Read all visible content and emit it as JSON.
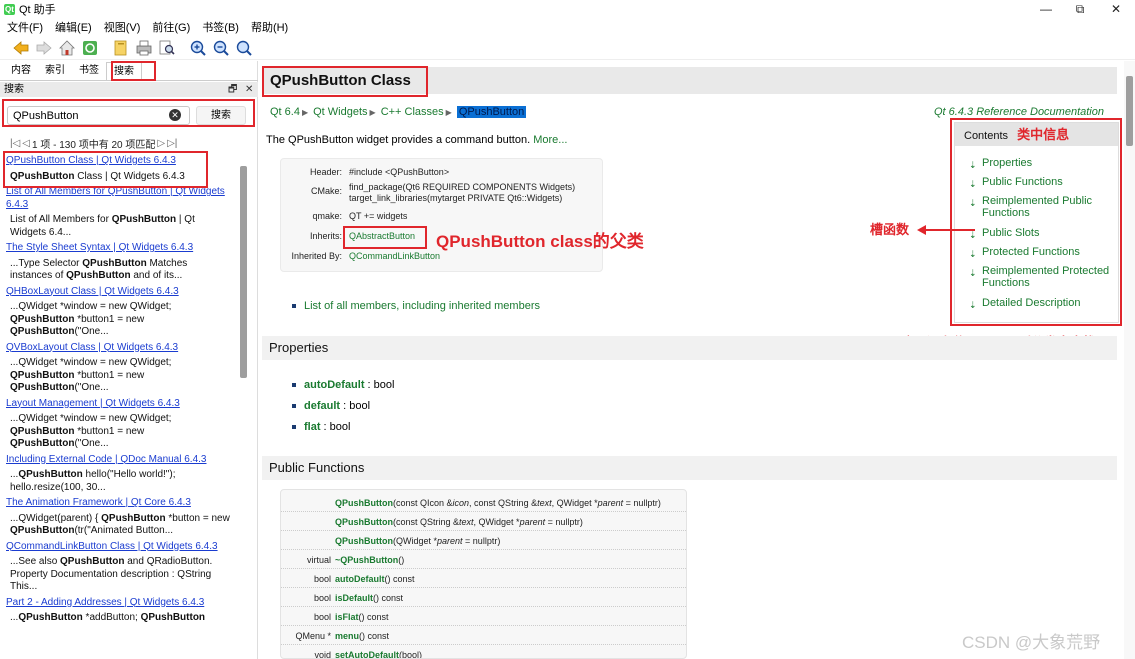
{
  "window": {
    "title": "Qt 助手",
    "minimize": "—",
    "maximize": "⧉",
    "close": "✕"
  },
  "menu": [
    "文件(F)",
    "编辑(E)",
    "视图(V)",
    "前往(G)",
    "书签(B)",
    "帮助(H)"
  ],
  "toolbar_icons": [
    "back-arrow-icon",
    "forward-arrow-icon",
    "home-icon",
    "sync-icon",
    "bookmarks-icon",
    "print-icon",
    "find-icon",
    "zoom-in-icon",
    "zoom-out-icon",
    "zoom-reset-icon"
  ],
  "left_tabs": [
    {
      "label": "内容"
    },
    {
      "label": "索引"
    },
    {
      "label": "书签"
    },
    {
      "label": "搜索"
    }
  ],
  "dock": {
    "title": "搜索",
    "float": "🗗",
    "close": "✕"
  },
  "search": {
    "query": "QPushButton",
    "button": "搜索",
    "clear": "✕"
  },
  "pager": {
    "first": "|◁",
    "prev": "◁",
    "text": "1 项 - 130 项中有 20 项匹配",
    "next": "▷",
    "last": "▷|"
  },
  "results": [
    {
      "link": "QPushButton Class | Qt Widgets 6.4.3",
      "snippet": [
        {
          "b": true,
          "t": "QPushButton"
        },
        {
          "b": false,
          "t": " Class | Qt Widgets 6.4.3"
        }
      ]
    },
    {
      "link": "List of All Members for QPushButton | Qt Widgets 6.4.3",
      "snippet": [
        {
          "b": false,
          "t": "List of All Members for "
        },
        {
          "b": true,
          "t": "QPushButton"
        },
        {
          "b": false,
          "t": " | Qt Widgets 6.4..."
        }
      ]
    },
    {
      "link": "The Style Sheet Syntax | Qt Widgets 6.4.3",
      "snippet": [
        {
          "b": false,
          "t": "...Type Selector "
        },
        {
          "b": true,
          "t": "QPushButton"
        },
        {
          "b": false,
          "t": " Matches instances of "
        },
        {
          "b": true,
          "t": "QPushButton"
        },
        {
          "b": false,
          "t": " and of its..."
        }
      ]
    },
    {
      "link": "QHBoxLayout Class | Qt Widgets 6.4.3",
      "snippet": [
        {
          "b": false,
          "t": "...QWidget *window = new QWidget; "
        },
        {
          "b": true,
          "t": "QPushButton"
        },
        {
          "b": false,
          "t": " *button1 = new "
        },
        {
          "b": true,
          "t": "QPushButton"
        },
        {
          "b": false,
          "t": "(\"One..."
        }
      ]
    },
    {
      "link": "QVBoxLayout Class | Qt Widgets 6.4.3",
      "snippet": [
        {
          "b": false,
          "t": "...QWidget *window = new QWidget; "
        },
        {
          "b": true,
          "t": "QPushButton"
        },
        {
          "b": false,
          "t": " *button1 = new "
        },
        {
          "b": true,
          "t": "QPushButton"
        },
        {
          "b": false,
          "t": "(\"One..."
        }
      ]
    },
    {
      "link": "Layout Management | Qt Widgets 6.4.3",
      "snippet": [
        {
          "b": false,
          "t": "...QWidget *window = new QWidget; "
        },
        {
          "b": true,
          "t": "QPushButton"
        },
        {
          "b": false,
          "t": " *button1 = new "
        },
        {
          "b": true,
          "t": "QPushButton"
        },
        {
          "b": false,
          "t": "(\"One..."
        }
      ]
    },
    {
      "link": "Including External Code | QDoc Manual 6.4.3",
      "snippet": [
        {
          "b": false,
          "t": "..."
        },
        {
          "b": true,
          "t": "QPushButton"
        },
        {
          "b": false,
          "t": " hello(\"Hello world!\"); hello.resize(100, 30..."
        }
      ]
    },
    {
      "link": "The Animation Framework | Qt Core 6.4.3",
      "snippet": [
        {
          "b": false,
          "t": "...QWidget(parent) { "
        },
        {
          "b": true,
          "t": "QPushButton"
        },
        {
          "b": false,
          "t": " *button = new "
        },
        {
          "b": true,
          "t": "QPushButton"
        },
        {
          "b": false,
          "t": "(tr(\"Animated Button..."
        }
      ]
    },
    {
      "link": "QCommandLinkButton Class | Qt Widgets 6.4.3",
      "snippet": [
        {
          "b": false,
          "t": "...See also "
        },
        {
          "b": true,
          "t": "QPushButton"
        },
        {
          "b": false,
          "t": " and QRadioButton. Property Documentation description : QString This..."
        }
      ]
    },
    {
      "link": "Part 2 - Adding Addresses | Qt Widgets 6.4.3",
      "snippet": [
        {
          "b": false,
          "t": "..."
        },
        {
          "b": true,
          "t": "QPushButton"
        },
        {
          "b": false,
          "t": " *addButton; "
        },
        {
          "b": true,
          "t": "QPushButton"
        }
      ]
    }
  ],
  "doc": {
    "title": "QPushButton Class",
    "breadcrumbs": [
      "Qt 6.4",
      "Qt Widgets",
      "C++ Classes",
      "QPushButton"
    ],
    "crumb_arrow": "▶",
    "ref": "Qt 6.4.3 Reference Documentation",
    "intro": "The QPushButton widget provides a command button.",
    "more": "More...",
    "info": [
      {
        "key": "Header:",
        "value": [
          "#include <QPushButton>"
        ],
        "link": false
      },
      {
        "key": "CMake:",
        "value": [
          "find_package(Qt6 REQUIRED COMPONENTS Widgets)",
          "target_link_libraries(mytarget PRIVATE Qt6::Widgets)"
        ],
        "link": false
      },
      {
        "key": "qmake:",
        "value": [
          "QT += widgets"
        ],
        "link": false
      },
      {
        "key": "Inherits:",
        "value": [
          "QAbstractButton"
        ],
        "link": true
      },
      {
        "key": "Inherited By:",
        "value": [
          "QCommandLinkButton"
        ],
        "link": true
      }
    ],
    "members_link": "List of all members, including inherited members",
    "contents_title": "Contents",
    "contents": [
      "Properties",
      "Public Functions",
      "Reimplemented Public Functions",
      "Public Slots",
      "Protected Functions",
      "Reimplemented Protected Functions",
      "Detailed Description"
    ],
    "contents_arrow": "⇣",
    "properties_heading": "Properties",
    "properties": [
      {
        "name": "autoDefault",
        "type": " : bool"
      },
      {
        "name": "default",
        "type": " : bool"
      },
      {
        "name": "flat",
        "type": " : bool"
      }
    ],
    "public_functions_heading": "Public Functions",
    "functions": [
      {
        "ret": "",
        "parts": [
          {
            "b": true,
            "t": "QPushButton"
          },
          {
            "b": false,
            "t": "(const QIcon &"
          },
          {
            "i": true,
            "t": "icon"
          },
          {
            "b": false,
            "t": ", const QString &"
          },
          {
            "i": true,
            "t": "text"
          },
          {
            "b": false,
            "t": ", QWidget *"
          },
          {
            "i": true,
            "t": "parent"
          },
          {
            "b": false,
            "t": " = nullptr)"
          }
        ]
      },
      {
        "ret": "",
        "parts": [
          {
            "b": true,
            "t": "QPushButton"
          },
          {
            "b": false,
            "t": "(const QString &"
          },
          {
            "i": true,
            "t": "text"
          },
          {
            "b": false,
            "t": ", QWidget *"
          },
          {
            "i": true,
            "t": "parent"
          },
          {
            "b": false,
            "t": " = nullptr)"
          }
        ]
      },
      {
        "ret": "",
        "parts": [
          {
            "b": true,
            "t": "QPushButton"
          },
          {
            "b": false,
            "t": "(QWidget *"
          },
          {
            "i": true,
            "t": "parent"
          },
          {
            "b": false,
            "t": " = nullptr)"
          }
        ]
      },
      {
        "ret": "virtual",
        "parts": [
          {
            "b": true,
            "t": "~QPushButton"
          },
          {
            "b": false,
            "t": "()"
          }
        ]
      },
      {
        "ret": "bool",
        "parts": [
          {
            "b": true,
            "t": "autoDefault"
          },
          {
            "b": false,
            "t": "() const"
          }
        ]
      },
      {
        "ret": "bool",
        "parts": [
          {
            "b": true,
            "t": "isDefault"
          },
          {
            "b": false,
            "t": "() const"
          }
        ]
      },
      {
        "ret": "bool",
        "parts": [
          {
            "b": true,
            "t": "isFlat"
          },
          {
            "b": false,
            "t": "() const"
          }
        ]
      },
      {
        "ret": "QMenu *",
        "parts": [
          {
            "b": true,
            "t": "menu"
          },
          {
            "b": false,
            "t": "() const"
          }
        ]
      },
      {
        "ret": "void",
        "parts": [
          {
            "b": true,
            "t": "setAutoDefault"
          },
          {
            "b": false,
            "t": "(bool)"
          }
        ]
      }
    ]
  },
  "annotations": {
    "class_info": "类中信息",
    "parent_class": "QPushButton class的父类",
    "slots": "槽函数",
    "no_signals": "这里没有信号，需要到父类中查找"
  },
  "watermark": "CSDN @大象荒野",
  "colors": {
    "accent_green": "#1a7a30",
    "annotation_red": "#e0262c",
    "link_blue": "#1a3cd0"
  }
}
